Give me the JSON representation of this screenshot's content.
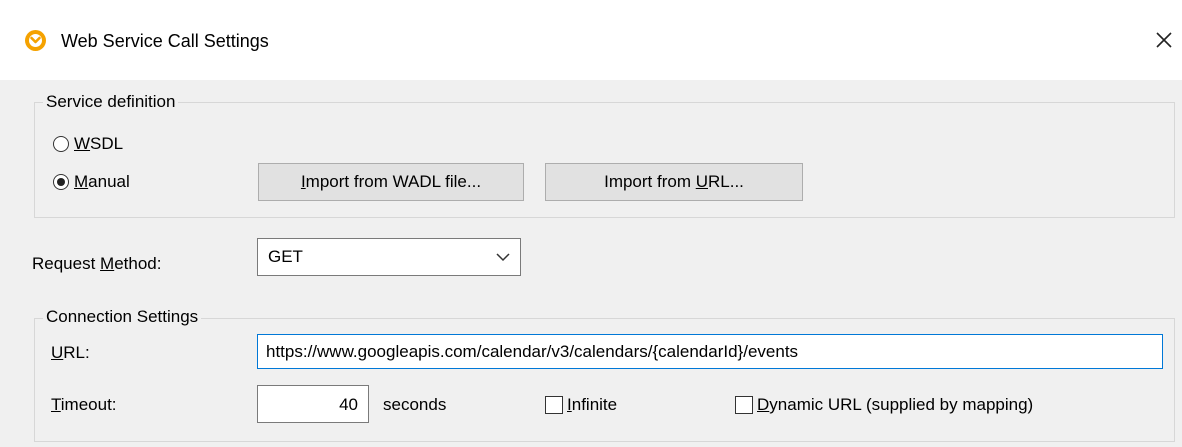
{
  "window": {
    "title": "Web Service Call Settings",
    "icon": "altova-mapforce-icon",
    "close_icon": "close-icon"
  },
  "service_definition": {
    "group_label": "Service definition",
    "wsdl": {
      "mnemonic": "W",
      "rest": "SDL",
      "checked": false
    },
    "manual": {
      "mnemonic": "M",
      "rest": "anual",
      "checked": true
    },
    "import_wadl": {
      "prefix": "",
      "mnemonic": "I",
      "rest": "mport from WADL file..."
    },
    "import_url": {
      "prefix": "Import from ",
      "mnemonic": "U",
      "rest": "RL..."
    }
  },
  "request_method": {
    "label_prefix": "Request ",
    "label_mnemonic": "M",
    "label_rest": "ethod:",
    "value": "GET"
  },
  "connection": {
    "group_label": "Connection Settings",
    "url_mnemonic": "U",
    "url_rest": "RL:",
    "url_value": "https://www.googleapis.com/calendar/v3/calendars/{calendarId}/events",
    "timeout_mnemonic": "T",
    "timeout_rest": "imeout:",
    "timeout_value": "40",
    "seconds_label": "seconds",
    "infinite_mnemonic": "I",
    "infinite_rest": "nfinite",
    "infinite_checked": false,
    "dynamic_mnemonic": "D",
    "dynamic_rest": "ynamic URL (supplied by mapping)",
    "dynamic_checked": false
  },
  "colors": {
    "accent": "#0078d7",
    "app_icon": "#f5a200",
    "background": "#f0f0f0"
  }
}
